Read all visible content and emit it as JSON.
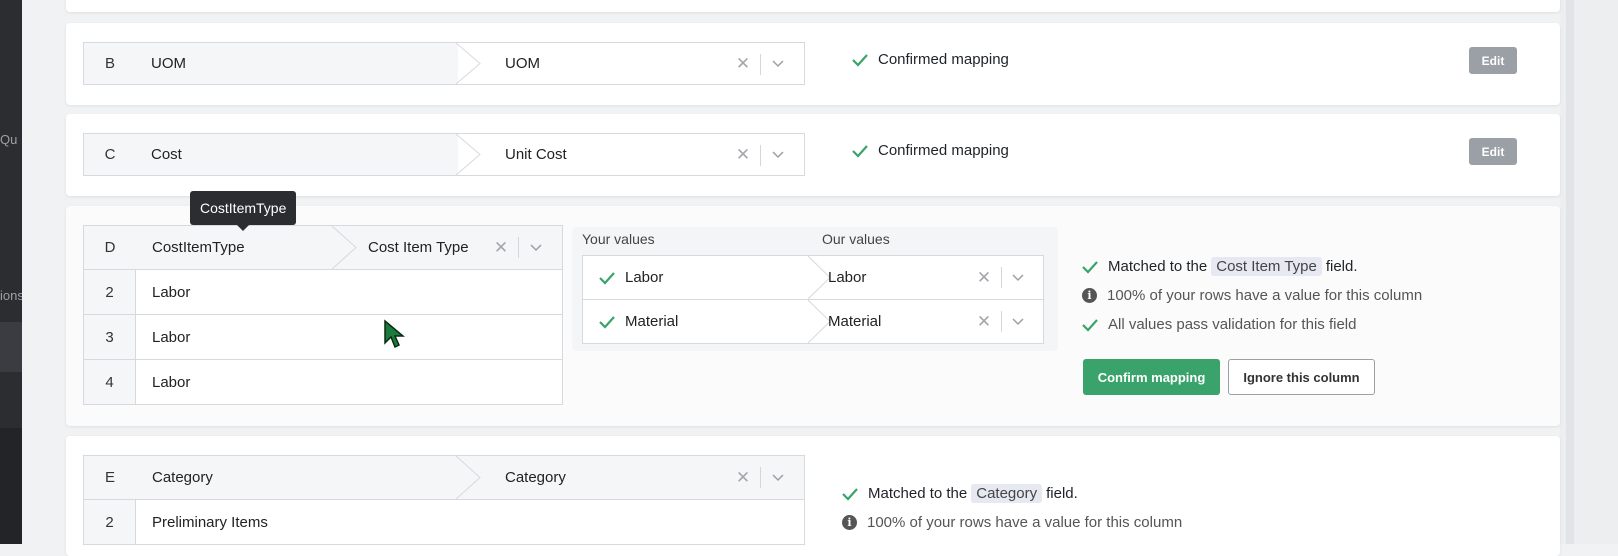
{
  "left_sidebar": {
    "fragments": [
      "Qu",
      "ions"
    ]
  },
  "rows": {
    "b": {
      "letter": "B",
      "source": "UOM",
      "target": "UOM",
      "status": "Confirmed mapping",
      "edit_label": "Edit"
    },
    "c": {
      "letter": "C",
      "source": "Cost",
      "target": "Unit Cost",
      "status": "Confirmed mapping",
      "edit_label": "Edit"
    }
  },
  "row_d": {
    "tooltip": "CostItemType",
    "letter": "D",
    "source": "CostItemType",
    "target": "Cost Item Type",
    "samples": [
      {
        "row": "2",
        "value": "Labor"
      },
      {
        "row": "3",
        "value": "Labor"
      },
      {
        "row": "4",
        "value": "Labor"
      }
    ],
    "values_panel": {
      "your_label": "Your values",
      "our_label": "Our values",
      "pairs": [
        {
          "yours": "Labor",
          "ours": "Labor"
        },
        {
          "yours": "Material",
          "ours": "Material"
        }
      ]
    },
    "info": {
      "matched_prefix": "Matched to the",
      "matched_field": "Cost Item Type",
      "matched_suffix": "field.",
      "rows_with_value": "100% of your rows have a value for this column",
      "validation": "All values pass validation for this field"
    },
    "confirm_label": "Confirm mapping",
    "ignore_label": "Ignore this column"
  },
  "row_e": {
    "letter": "E",
    "source": "Category",
    "target": "Category",
    "samples": [
      {
        "row": "2",
        "value": "Preliminary Items"
      }
    ],
    "info": {
      "matched_prefix": "Matched to the",
      "matched_field": "Category",
      "matched_suffix": "field.",
      "rows_with_value": "100% of your rows have a value for this column"
    }
  },
  "colors": {
    "accent_green": "#3aa36b",
    "edit_gray": "#9aa0a6",
    "highlight": "#e6e8f2"
  },
  "icons": [
    "check-icon",
    "close-icon",
    "chevron-down-icon",
    "info-icon",
    "mouse-cursor-icon"
  ]
}
